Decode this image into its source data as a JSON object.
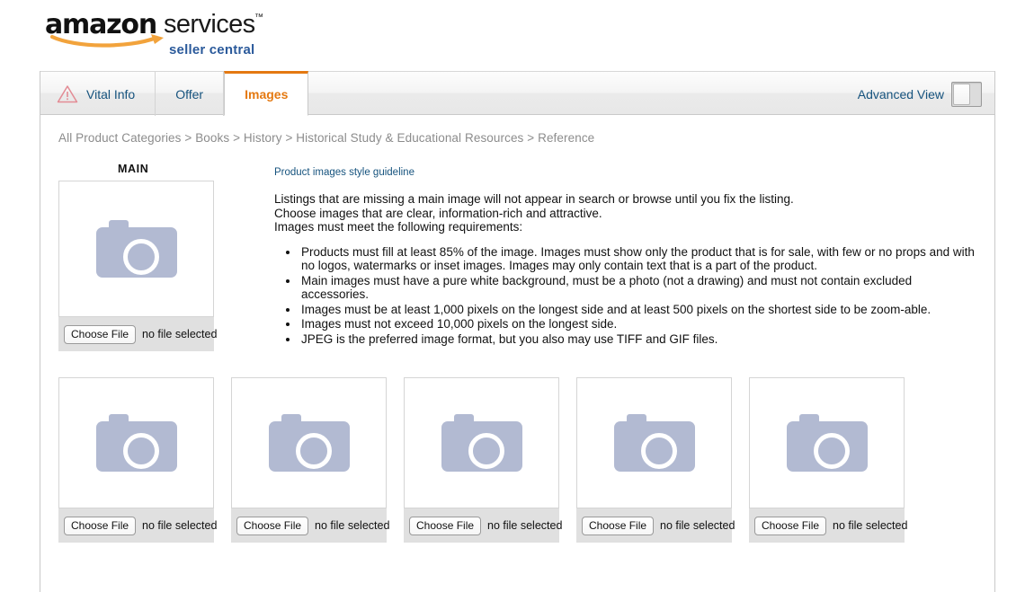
{
  "logo": {
    "amazon": "amazon",
    "services": "services",
    "tm": "™",
    "tagline": "seller central"
  },
  "tabs": {
    "items": [
      {
        "label": "Vital Info",
        "icon": "warning-triangle-icon",
        "active": false,
        "has_warning": true
      },
      {
        "label": "Offer",
        "icon": "",
        "active": false,
        "has_warning": false
      },
      {
        "label": "Images",
        "icon": "",
        "active": true,
        "has_warning": false
      }
    ],
    "advanced_view_label": "Advanced View",
    "advanced_view_state": "off"
  },
  "breadcrumb": {
    "text": "All Product Categories > Books > History > Historical Study & Educational Resources > Reference"
  },
  "main_image": {
    "label": "MAIN",
    "placeholder_icon": "camera-icon",
    "file_button": "Choose File",
    "file_status": "no file selected"
  },
  "instructions": {
    "style_guideline_link": "Product images style guideline",
    "intro_lines": [
      "Listings that are missing a main image will not appear in search or browse until you fix the listing.",
      "Choose images that are clear, information-rich and attractive.",
      "Images must meet the following requirements:"
    ],
    "requirements": [
      "Products must fill at least 85% of the image. Images must show only the product that is for sale, with few or no props and with no logos, watermarks or inset images. Images may only contain text that is a part of the product.",
      "Main images must have a pure white background, must be a photo (not a drawing) and must not contain excluded accessories.",
      "Images must be at least 1,000 pixels on the longest side and at least 500 pixels on the shortest side to be zoom-able.",
      "Images must not exceed 10,000 pixels on the longest side.",
      "JPEG is the preferred image format, but you also may use TIFF and GIF files."
    ]
  },
  "alt_images": {
    "slots": [
      {
        "file_button": "Choose File",
        "file_status": "no file selected"
      },
      {
        "file_button": "Choose File",
        "file_status": "no file selected"
      },
      {
        "file_button": "Choose File",
        "file_status": "no file selected"
      },
      {
        "file_button": "Choose File",
        "file_status": "no file selected"
      },
      {
        "file_button": "Choose File",
        "file_status": "no file selected"
      }
    ]
  },
  "colors": {
    "accent_orange": "#e47911",
    "link_blue": "#16537e",
    "tagline_blue": "#2b5a9b",
    "camera_gray_blue": "#b2bad2",
    "warning_pink": "#e38b94",
    "breadcrumb_gray": "#8c8c8c"
  }
}
